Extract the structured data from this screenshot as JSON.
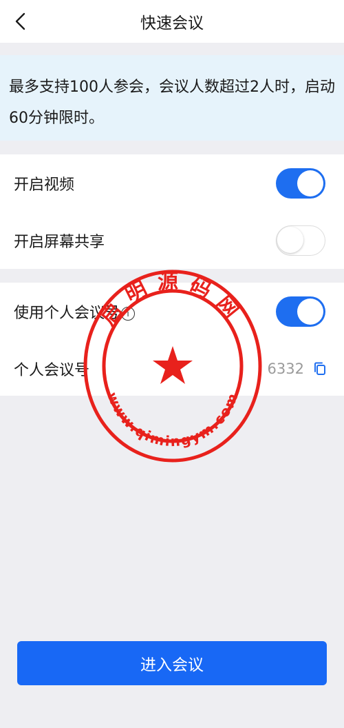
{
  "header": {
    "title": "快速会议"
  },
  "notice": {
    "text": "最多支持100人参会，会议人数超过2人时，启动60分钟限时。"
  },
  "settings": {
    "video": {
      "label": "开启视频",
      "enabled": true
    },
    "screen_share": {
      "label": "开启屏幕共享",
      "enabled": false
    },
    "personal_meeting": {
      "label": "使用个人会议号",
      "enabled": true
    },
    "meeting_no": {
      "label": "个人会议号",
      "value": "6332"
    }
  },
  "actions": {
    "enter_label": "进入会议"
  },
  "watermark": {
    "top_text": "启明源码网",
    "bottom_text": "www.qimingym.com"
  },
  "colors": {
    "accent": "#1e6ef0",
    "button": "#1868f5",
    "notice_bg": "#e6f3fb",
    "page_bg": "#eeeef2",
    "stamp": "#e8211c"
  }
}
